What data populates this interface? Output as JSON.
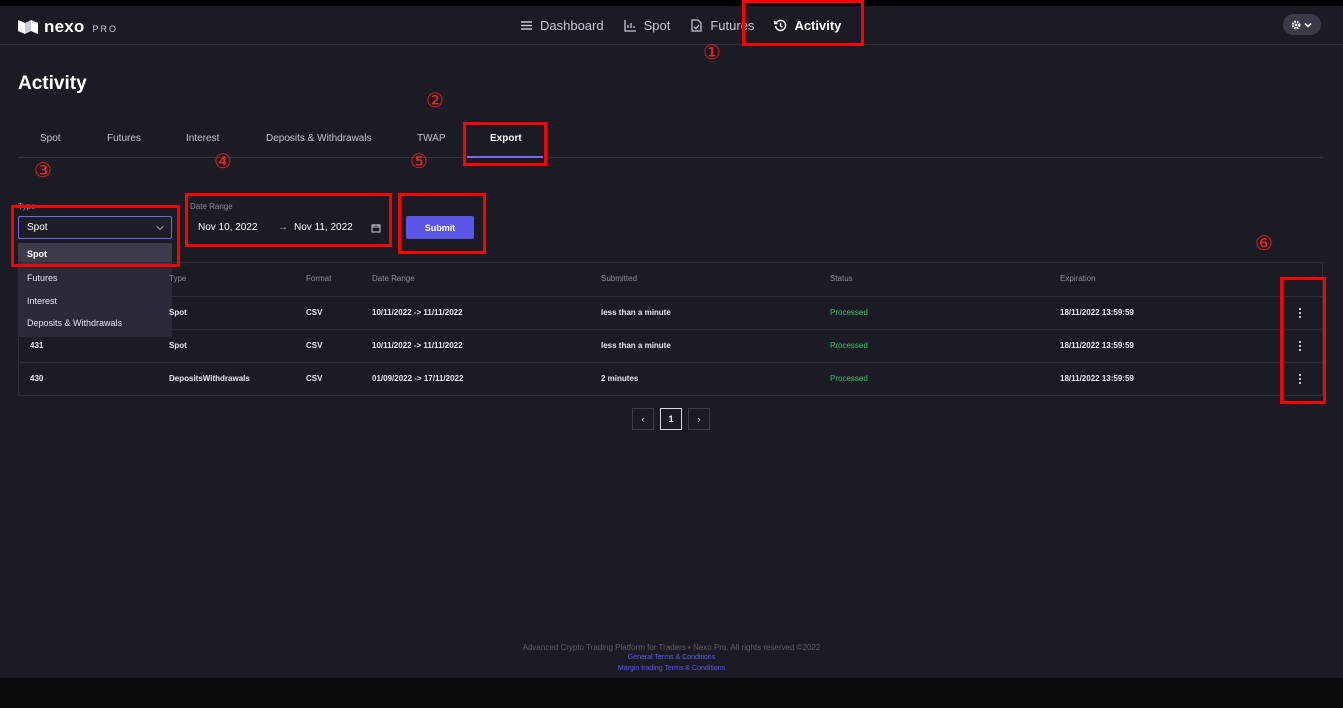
{
  "brand": {
    "name": "nexo",
    "sub": "PRO"
  },
  "nav": {
    "items": [
      {
        "label": "Dashboard",
        "icon": "menu-icon"
      },
      {
        "label": "Spot",
        "icon": "bar-chart-icon"
      },
      {
        "label": "Futures",
        "icon": "document-icon"
      },
      {
        "label": "Activity",
        "icon": "history-icon",
        "active": true
      }
    ]
  },
  "page": {
    "title": "Activity"
  },
  "tabs": [
    "Spot",
    "Futures",
    "Interest",
    "Deposits & Withdrawals",
    "TWAP",
    "Export"
  ],
  "active_tab": "Export",
  "form": {
    "type_label": "Type",
    "type_value": "Spot",
    "type_options": [
      "Spot",
      "Futures",
      "Interest",
      "Deposits & Withdrawals"
    ],
    "date_label": "Date Range",
    "date_from": "Nov 10, 2022",
    "date_arrow": "→",
    "date_to": "Nov 11, 2022",
    "submit_label": "Submit"
  },
  "table": {
    "headers": [
      "Type",
      "Format",
      "Date Range",
      "Submitted",
      "Status",
      "Expiration"
    ],
    "rows": [
      {
        "id": "",
        "type": "Spot",
        "format": "CSV",
        "range": "10/11/2022 -> 11/11/2022",
        "submitted": "less than a minute",
        "status": "Processed",
        "expiration": "18/11/2022 13:59:59"
      },
      {
        "id": "431",
        "type": "Spot",
        "format": "CSV",
        "range": "10/11/2022 -> 11/11/2022",
        "submitted": "less than a minute",
        "status": "Processed",
        "expiration": "18/11/2022 13:59:59"
      },
      {
        "id": "430",
        "type": "DepositsWithdrawals",
        "format": "CSV",
        "range": "01/09/2022 -> 17/11/2022",
        "submitted": "2 minutes",
        "status": "Processed",
        "expiration": "18/11/2022 13:59:59"
      }
    ]
  },
  "pagination": {
    "prev": "‹",
    "current": "1",
    "next": "›"
  },
  "footer": {
    "copyright": "Advanced Crypto Trading Platform for Traders • Nexo Pro. All rights reserved ©2022",
    "link_general": "General Terms & Conditions",
    "link_margin": "Margin trading Terms & Conditions"
  },
  "annotations": [
    "①",
    "②",
    "③",
    "④",
    "⑤",
    "⑥"
  ],
  "colors": {
    "accent": "#5a55e6",
    "status_ok": "#35c46a",
    "annotation": "#ff0000"
  }
}
